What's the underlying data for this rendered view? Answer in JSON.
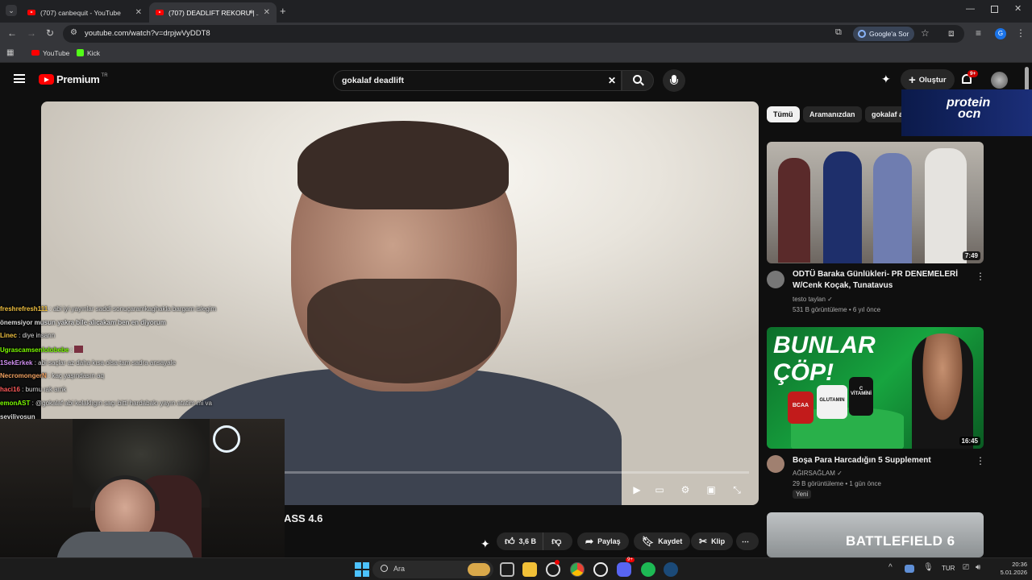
{
  "browser": {
    "tabs": [
      {
        "title": "(707) canbequit - YouTube",
        "active": false
      },
      {
        "title": "(707) DEADLIFT REKORU | ...",
        "active": true
      }
    ],
    "url": "youtube.com/watch?v=drpjwVyDDT8",
    "google_button": "Google'a Sor",
    "bookmarks": [
      "YouTube",
      "Kick"
    ]
  },
  "youtube": {
    "logo": "Premium",
    "logo_region": "TR",
    "search_value": "gokalaf deadlift",
    "create_label": "Oluştur",
    "notif_badge": "9+"
  },
  "ad_banner": {
    "line1": "protein",
    "line2": "ocn"
  },
  "chips": [
    "Tümü",
    "Aramanızdan",
    "gokalaf a"
  ],
  "chat": [
    {
      "user": "freshrefresh111",
      "text": ": abi iyi yayınlar saddi sonuçaramkaghakla bargam islegim",
      "color": "#f0c040"
    },
    {
      "user": "",
      "text": "önemsiyor musun yakra bile alıcakam ben en diyorum",
      "color": "#ffffff"
    },
    {
      "user": "Linec",
      "text": ": diye insann",
      "color": "#f0c040"
    },
    {
      "user": "Ugrascamsenlolobebe",
      "text": ":",
      "color": "#7cfc00"
    },
    {
      "user": "1SekErkek",
      "text": ": abi saçlar az daha kısa olsa tam sadra ansayale",
      "color": "#d08ff0"
    },
    {
      "user": "NecromongerN",
      "text": ": kaç yaşındasın aq",
      "color": "#f0a060"
    },
    {
      "user": "haci16",
      "text": ": burnu ıak aınk",
      "color": "#ff5a5a"
    },
    {
      "user": "emonAST",
      "text": ": @gokalaf abi kolaklıgın saçı bitti hardabakı yayın atatim mi va",
      "color": "#7cfc00"
    },
    {
      "user": "",
      "text": "seviliyosun",
      "color": "#ffffff"
    }
  ],
  "video": {
    "title_partial": "ASS 4.6",
    "likes": "3,6 B",
    "share": "Paylaş",
    "save": "Kaydet",
    "clip": "Klip"
  },
  "sidebar": [
    {
      "title": "ODTÜ Baraka Günlükleri- PR DENEMELERİ W/Cenk Koçak, Tunatavus",
      "channel": "testo taylan",
      "meta": "531 B görüntüleme • 6 yıl önce",
      "duration": "7:49",
      "badge": ""
    },
    {
      "title": "Boşa Para Harcadığın 5 Supplement",
      "channel": "AĞIRSAĞLAM",
      "meta": "29 B görüntüleme • 1 gün önce",
      "duration": "16:45",
      "badge": "Yeni",
      "thumb_text1": "BUNLAR",
      "thumb_text2": "ÇÖP!",
      "jar1": "BCAA",
      "jar2": "GLUTAMIN",
      "jar3": "C VİTAMİNİ"
    },
    {
      "thumb_text": "BATTLEFIELD 6"
    }
  ],
  "taskbar": {
    "search": "Ara",
    "lang": "TUR",
    "time": "20:36",
    "date": "5.01.2026",
    "discord_badge": "9+"
  }
}
